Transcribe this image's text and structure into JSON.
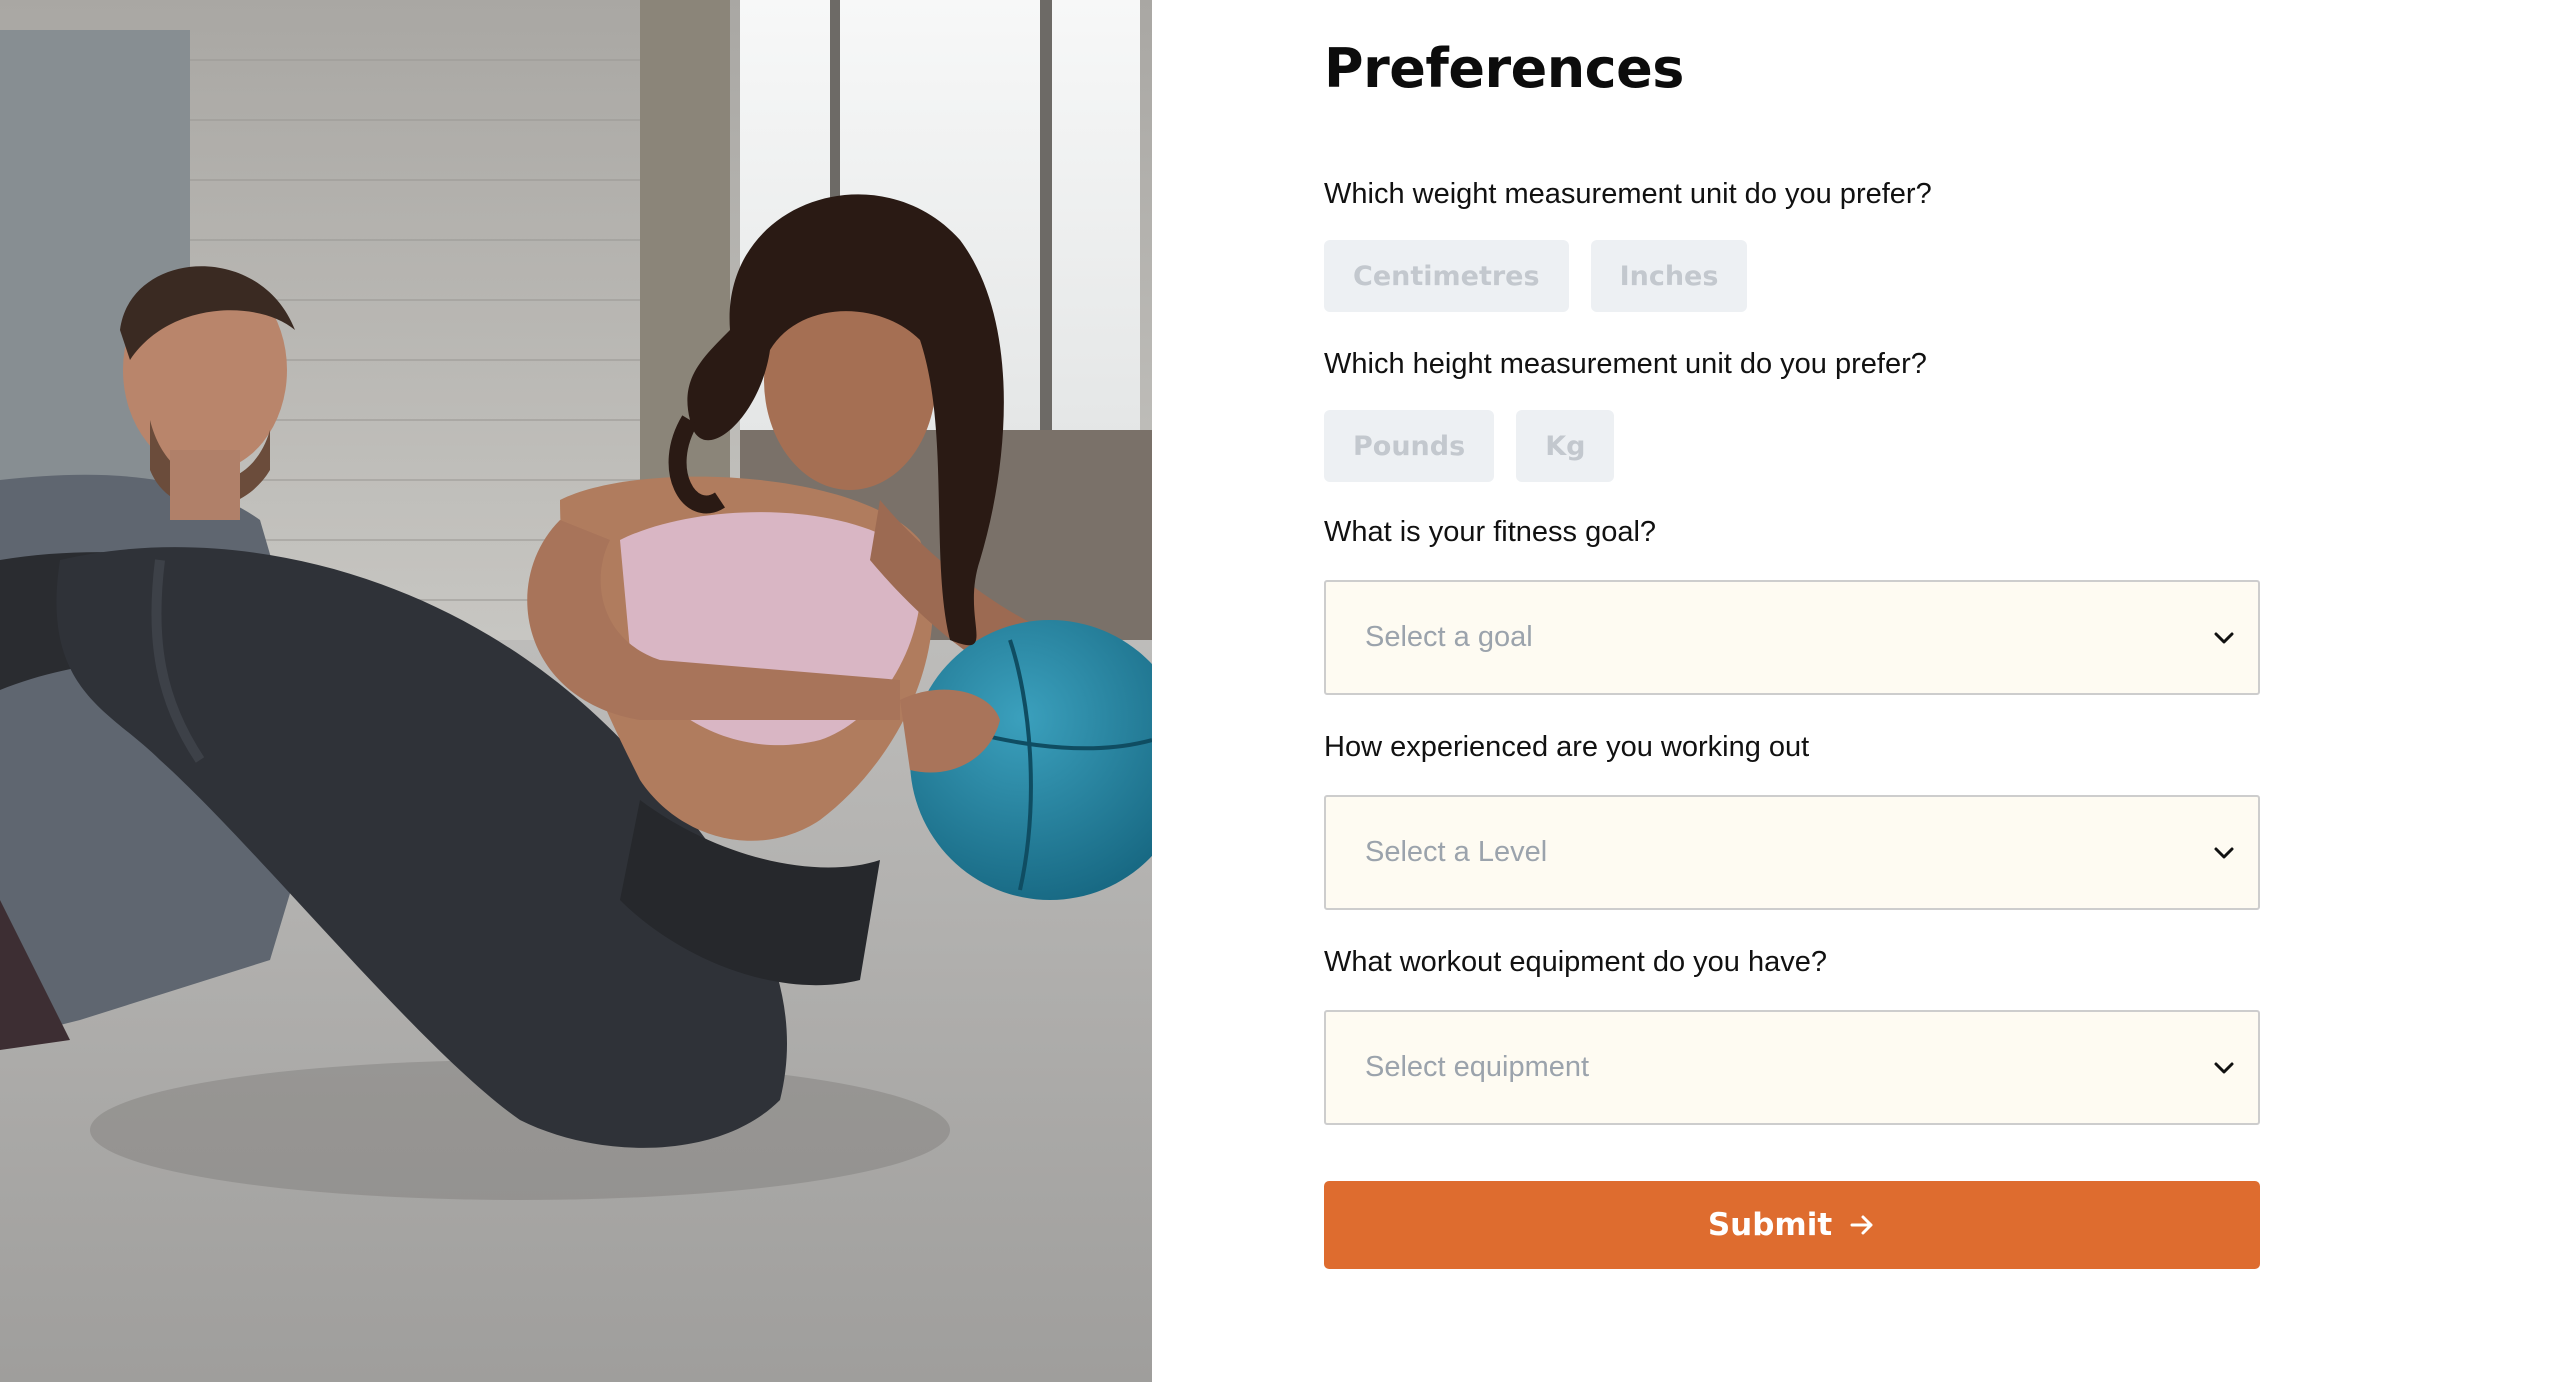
{
  "hero_image": {
    "alt": "Two people doing a seated twist exercise with a blue medicine ball on a concrete gym floor",
    "icon": "photo-illustration"
  },
  "form": {
    "title": "Preferences",
    "weight_question": {
      "label": "Which weight measurement unit do you prefer?",
      "options": [
        "Centimetres",
        "Inches"
      ]
    },
    "height_question": {
      "label": "Which height measurement unit do you prefer?",
      "options": [
        "Pounds",
        "Kg"
      ]
    },
    "goal_question": {
      "label": "What is your fitness goal?",
      "placeholder": "Select a goal"
    },
    "experience_question": {
      "label": "How experienced are you working out",
      "placeholder": "Select a Level"
    },
    "equipment_question": {
      "label": "What workout equipment do you have?",
      "placeholder": "Select equipment"
    },
    "submit": {
      "label": "Submit",
      "icon": "arrow-right-icon"
    }
  },
  "colors": {
    "accent": "#de6c2f",
    "chip_bg": "#edf0f3",
    "chip_text": "#c3c8ce",
    "select_bg": "#fefbf2",
    "select_border": "#cdcdcd",
    "placeholder_text": "#9ba3ac"
  }
}
